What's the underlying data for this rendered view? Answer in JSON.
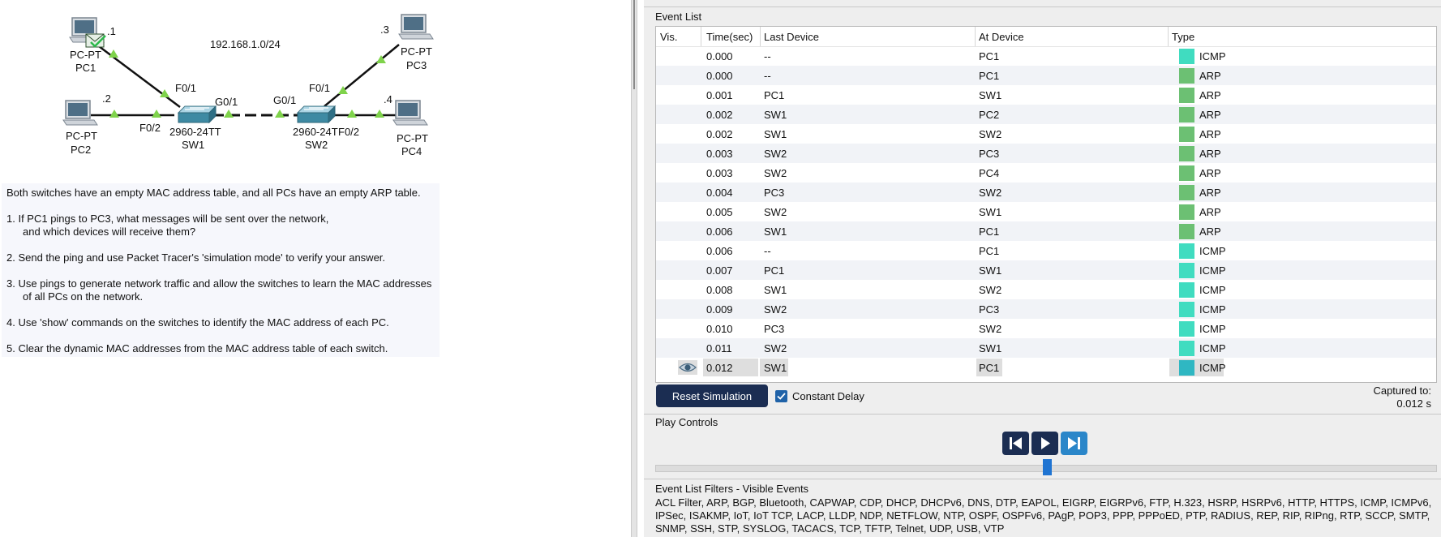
{
  "topology": {
    "network_label": "192.168.1.0/24",
    "pc1": {
      "type": "PC-PT",
      "name": "PC1",
      "ip_suffix": ".1"
    },
    "pc2": {
      "type": "PC-PT",
      "name": "PC2",
      "ip_suffix": ".2"
    },
    "pc3": {
      "type": "PC-PT",
      "name": "PC3",
      "ip_suffix": ".3"
    },
    "pc4": {
      "type": "PC-PT",
      "name": "PC4",
      "ip_suffix": ".4"
    },
    "sw1": {
      "model": "2960-24TT",
      "name": "SW1"
    },
    "sw2": {
      "model": "2960-24T",
      "name": "SW2"
    },
    "ports": {
      "sw1_f01": "F0/1",
      "sw1_f02": "F0/2",
      "sw1_g01": "G0/1",
      "sw2_g01": "G0/1",
      "sw2_f01": "F0/1",
      "sw2_f02": "F0/2"
    }
  },
  "instructions": {
    "intro": "Both switches have an empty MAC address table, and all PCs have an empty ARP table.",
    "q1_line1": "1. If PC1 pings to PC3, what messages will be sent over the network,",
    "q1_line2": "and which devices will receive them?",
    "q2": "2. Send the ping and use Packet Tracer's 'simulation mode' to verify your answer.",
    "q3_line1": "3. Use pings to generate network traffic and allow the switches to learn the MAC addresses",
    "q3_line2": "of all PCs on the network.",
    "q4": "4. Use 'show' commands on the switches to identify the MAC address of each PC.",
    "q5": "5. Clear the dynamic MAC addresses from the MAC address table of each switch."
  },
  "event_list": {
    "title": "Event List",
    "columns": {
      "vis": "Vis.",
      "time": "Time(sec)",
      "last_device": "Last Device",
      "at_device": "At Device",
      "type": "Type"
    },
    "rows": [
      {
        "time": "0.000",
        "last": "--",
        "at": "PC1",
        "type": "ICMP",
        "color": "#40dcc0"
      },
      {
        "time": "0.000",
        "last": "--",
        "at": "PC1",
        "type": "ARP",
        "color": "#6cc073"
      },
      {
        "time": "0.001",
        "last": "PC1",
        "at": "SW1",
        "type": "ARP",
        "color": "#6cc073"
      },
      {
        "time": "0.002",
        "last": "SW1",
        "at": "PC2",
        "type": "ARP",
        "color": "#6cc073"
      },
      {
        "time": "0.002",
        "last": "SW1",
        "at": "SW2",
        "type": "ARP",
        "color": "#6cc073"
      },
      {
        "time": "0.003",
        "last": "SW2",
        "at": "PC3",
        "type": "ARP",
        "color": "#6cc073"
      },
      {
        "time": "0.003",
        "last": "SW2",
        "at": "PC4",
        "type": "ARP",
        "color": "#6cc073"
      },
      {
        "time": "0.004",
        "last": "PC3",
        "at": "SW2",
        "type": "ARP",
        "color": "#6cc073"
      },
      {
        "time": "0.005",
        "last": "SW2",
        "at": "SW1",
        "type": "ARP",
        "color": "#6cc073"
      },
      {
        "time": "0.006",
        "last": "SW1",
        "at": "PC1",
        "type": "ARP",
        "color": "#6cc073"
      },
      {
        "time": "0.006",
        "last": "--",
        "at": "PC1",
        "type": "ICMP",
        "color": "#40dcc0"
      },
      {
        "time": "0.007",
        "last": "PC1",
        "at": "SW1",
        "type": "ICMP",
        "color": "#40dcc0"
      },
      {
        "time": "0.008",
        "last": "SW1",
        "at": "SW2",
        "type": "ICMP",
        "color": "#40dcc0"
      },
      {
        "time": "0.009",
        "last": "SW2",
        "at": "PC3",
        "type": "ICMP",
        "color": "#40dcc0"
      },
      {
        "time": "0.010",
        "last": "PC3",
        "at": "SW2",
        "type": "ICMP",
        "color": "#40dcc0"
      },
      {
        "time": "0.011",
        "last": "SW2",
        "at": "SW1",
        "type": "ICMP",
        "color": "#40dcc0"
      },
      {
        "time": "0.012",
        "last": "SW1",
        "at": "PC1",
        "type": "ICMP",
        "color": "#2fb7c2",
        "selected": true,
        "vis_icon": "eye-icon"
      }
    ]
  },
  "controls": {
    "reset_label": "Reset Simulation",
    "constant_delay_label": "Constant Delay",
    "constant_delay_checked": true,
    "captured_label": "Captured to:",
    "captured_value": "0.012 s"
  },
  "play_controls": {
    "title": "Play Controls",
    "buttons": [
      "step-back-icon",
      "play-icon",
      "step-forward-icon"
    ],
    "accent_dark": "#1b2d52",
    "accent_light": "#2a86c9"
  },
  "filters": {
    "title": "Event List Filters - Visible Events",
    "text": "ACL Filter, ARP, BGP, Bluetooth, CAPWAP, CDP, DHCP, DHCPv6, DNS, DTP, EAPOL, EIGRP, EIGRPv6, FTP, H.323, HSRP, HSRPv6, HTTP, HTTPS, ICMP, ICMPv6, IPSec, ISAKMP, IoT, IoT TCP, LACP, LLDP, NDP, NETFLOW, NTP, OSPF, OSPFv6, PAgP, POP3, PPP, PPPoED, PTP, RADIUS, REP, RIP, RIPng, RTP, SCCP, SMTP, SNMP, SSH, STP, SYSLOG, TACACS, TCP, TFTP, Telnet, UDP, USB, VTP"
  }
}
